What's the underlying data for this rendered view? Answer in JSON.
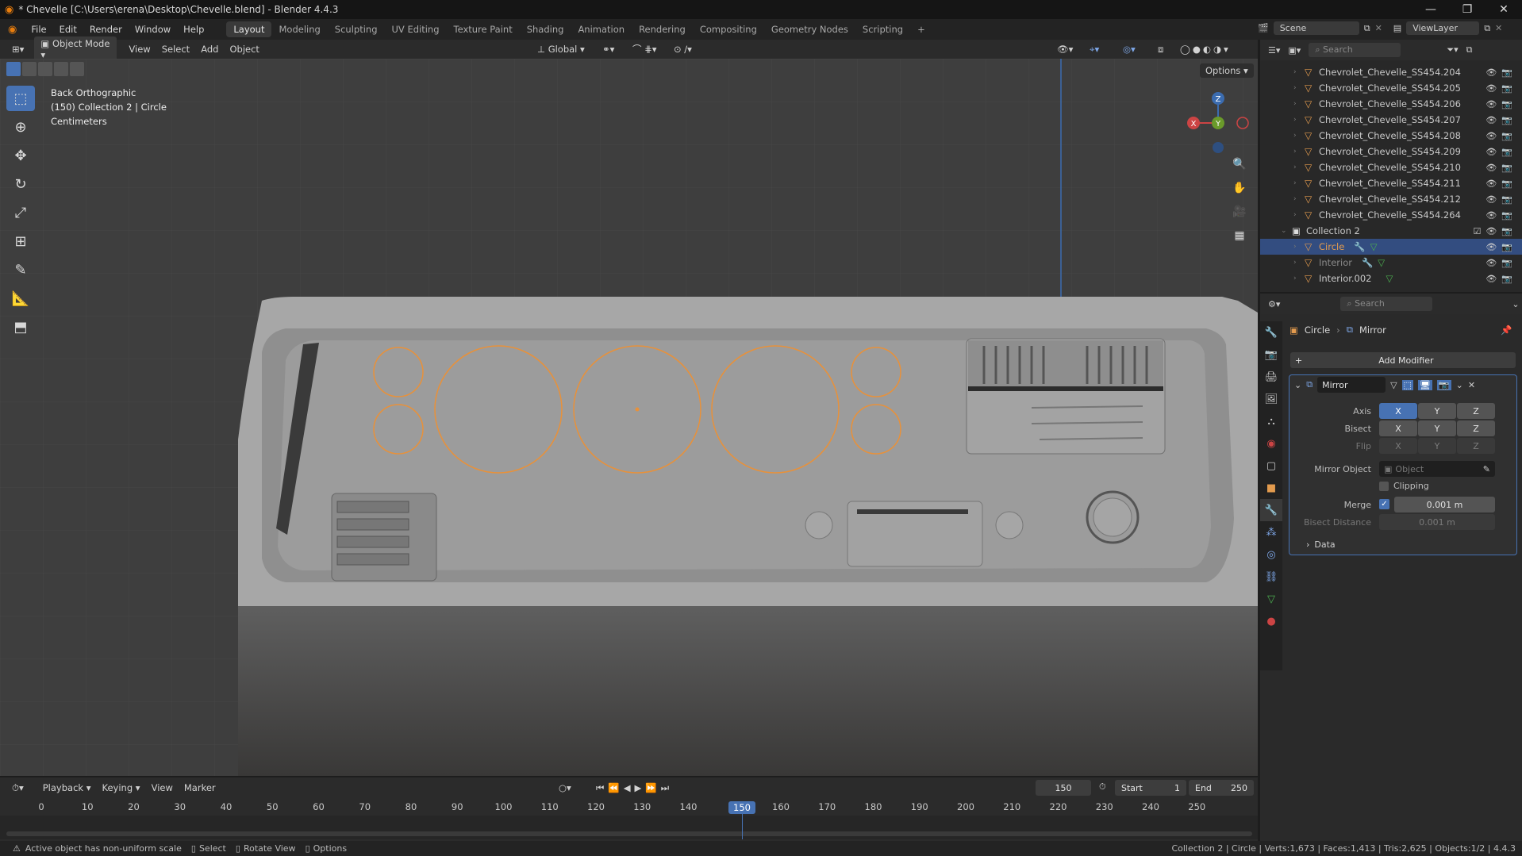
{
  "window": {
    "title": "* Chevelle [C:\\Users\\erena\\Desktop\\Chevelle.blend] - Blender 4.4.3"
  },
  "menu": {
    "items": [
      "File",
      "Edit",
      "Render",
      "Window",
      "Help"
    ],
    "workspaces": [
      "Layout",
      "Modeling",
      "Sculpting",
      "UV Editing",
      "Texture Paint",
      "Shading",
      "Animation",
      "Rendering",
      "Compositing",
      "Geometry Nodes",
      "Scripting"
    ],
    "active_workspace": "Layout",
    "scene_label": "Scene",
    "viewlayer_label": "ViewLayer"
  },
  "viewport_header": {
    "mode": "Object Mode",
    "menus": [
      "View",
      "Select",
      "Add",
      "Object"
    ],
    "transform_orientation": "Global",
    "options_label": "Options"
  },
  "viewport": {
    "view_name": "Back Orthographic",
    "collection_info": "(150) Collection 2 | Circle",
    "units": "Centimeters",
    "gizmo": {
      "z": "Z",
      "y": "Y",
      "x": "X"
    }
  },
  "outliner": {
    "search_placeholder": "Search",
    "objects": [
      "Chevrolet_Chevelle_SS454.204",
      "Chevrolet_Chevelle_SS454.205",
      "Chevrolet_Chevelle_SS454.206",
      "Chevrolet_Chevelle_SS454.207",
      "Chevrolet_Chevelle_SS454.208",
      "Chevrolet_Chevelle_SS454.209",
      "Chevrolet_Chevelle_SS454.210",
      "Chevrolet_Chevelle_SS454.211",
      "Chevrolet_Chevelle_SS454.212",
      "Chevrolet_Chevelle_SS454.264"
    ],
    "collection": "Collection 2",
    "collection_children": [
      "Circle",
      "Interior",
      "Interior.002"
    ],
    "selected": "Circle"
  },
  "properties": {
    "search_placeholder": "Search",
    "breadcrumb_object": "Circle",
    "breadcrumb_modifier": "Mirror",
    "add_modifier": "Add Modifier",
    "modifier_name": "Mirror",
    "axis_label": "Axis",
    "bisect_label": "Bisect",
    "flip_label": "Flip",
    "axes": [
      "X",
      "Y",
      "Z"
    ],
    "mirror_object_label": "Mirror Object",
    "mirror_object_placeholder": "Object",
    "clipping_label": "Clipping",
    "merge_label": "Merge",
    "merge_value": "0.001 m",
    "bisect_distance_label": "Bisect Distance",
    "bisect_distance_value": "0.001 m",
    "data_label": "Data"
  },
  "timeline": {
    "menus": [
      "Playback",
      "Keying",
      "View",
      "Marker"
    ],
    "current_frame": "150",
    "start_label": "Start",
    "start_value": "1",
    "end_label": "End",
    "end_value": "250",
    "ticks": [
      "0",
      "10",
      "20",
      "30",
      "40",
      "50",
      "60",
      "70",
      "80",
      "90",
      "100",
      "110",
      "120",
      "130",
      "140",
      "150",
      "160",
      "170",
      "180",
      "190",
      "200",
      "210",
      "220",
      "230",
      "240",
      "250"
    ]
  },
  "statusbar": {
    "warning": "Active object has non-uniform scale",
    "select": "Select",
    "rotate": "Rotate View",
    "options": "Options",
    "stats": "Collection 2 | Circle | Verts:1,673 | Faces:1,413 | Tris:2,625 | Objects:1/2 | 4.4.3"
  },
  "colors": {
    "accent": "#4772b3",
    "selection_orange": "#e8913a",
    "object_icon": "#e39b4e"
  }
}
